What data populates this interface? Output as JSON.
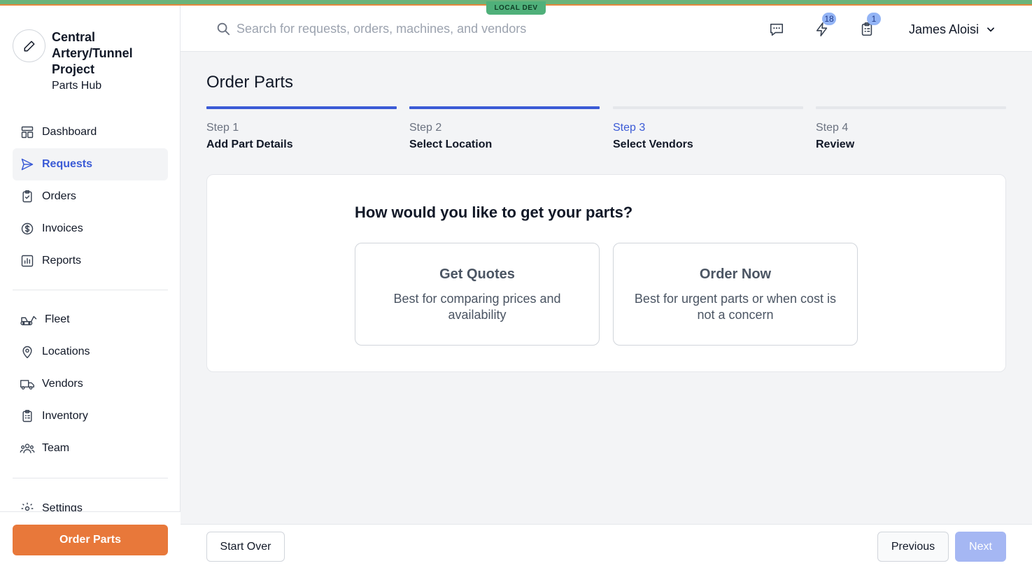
{
  "env_badge": "LOCAL DEV",
  "brand": {
    "title": "Central Artery/Tunnel Project",
    "subtitle": "Parts Hub"
  },
  "sidebar": {
    "primary": [
      {
        "label": "Dashboard",
        "icon": "dashboard-icon"
      },
      {
        "label": "Requests",
        "icon": "send-icon",
        "active": true
      },
      {
        "label": "Orders",
        "icon": "clipboard-check-icon"
      },
      {
        "label": "Invoices",
        "icon": "dollar-circle-icon"
      },
      {
        "label": "Reports",
        "icon": "bar-chart-icon"
      }
    ],
    "secondary": [
      {
        "label": "Fleet",
        "icon": "excavator-icon"
      },
      {
        "label": "Locations",
        "icon": "map-pin-icon"
      },
      {
        "label": "Vendors",
        "icon": "truck-icon"
      },
      {
        "label": "Inventory",
        "icon": "clipboard-list-icon"
      },
      {
        "label": "Team",
        "icon": "users-icon"
      }
    ],
    "settings_label": "Settings",
    "order_button": "Order Parts"
  },
  "header": {
    "search_placeholder": "Search for requests, orders, machines, and vendors",
    "notifications_count": "18",
    "tasks_count": "1",
    "user_name": "James Aloisi"
  },
  "page": {
    "title": "Order Parts",
    "steps": [
      {
        "num": "Step 1",
        "name": "Add Part Details",
        "state": "done"
      },
      {
        "num": "Step 2",
        "name": "Select Location",
        "state": "done"
      },
      {
        "num": "Step 3",
        "name": "Select Vendors",
        "state": "current"
      },
      {
        "num": "Step 4",
        "name": "Review",
        "state": "upcoming"
      }
    ],
    "question": "How would you like to get your parts?",
    "options": [
      {
        "title": "Get Quotes",
        "desc": "Best for comparing prices and availability"
      },
      {
        "title": "Order Now",
        "desc": "Best for urgent parts or when cost is not a concern"
      }
    ]
  },
  "footer": {
    "start_over": "Start Over",
    "previous": "Previous",
    "next": "Next"
  },
  "colors": {
    "accent": "#3b5bd6",
    "primary_button": "#e8783a",
    "env_stripe": "#6bb37a"
  }
}
